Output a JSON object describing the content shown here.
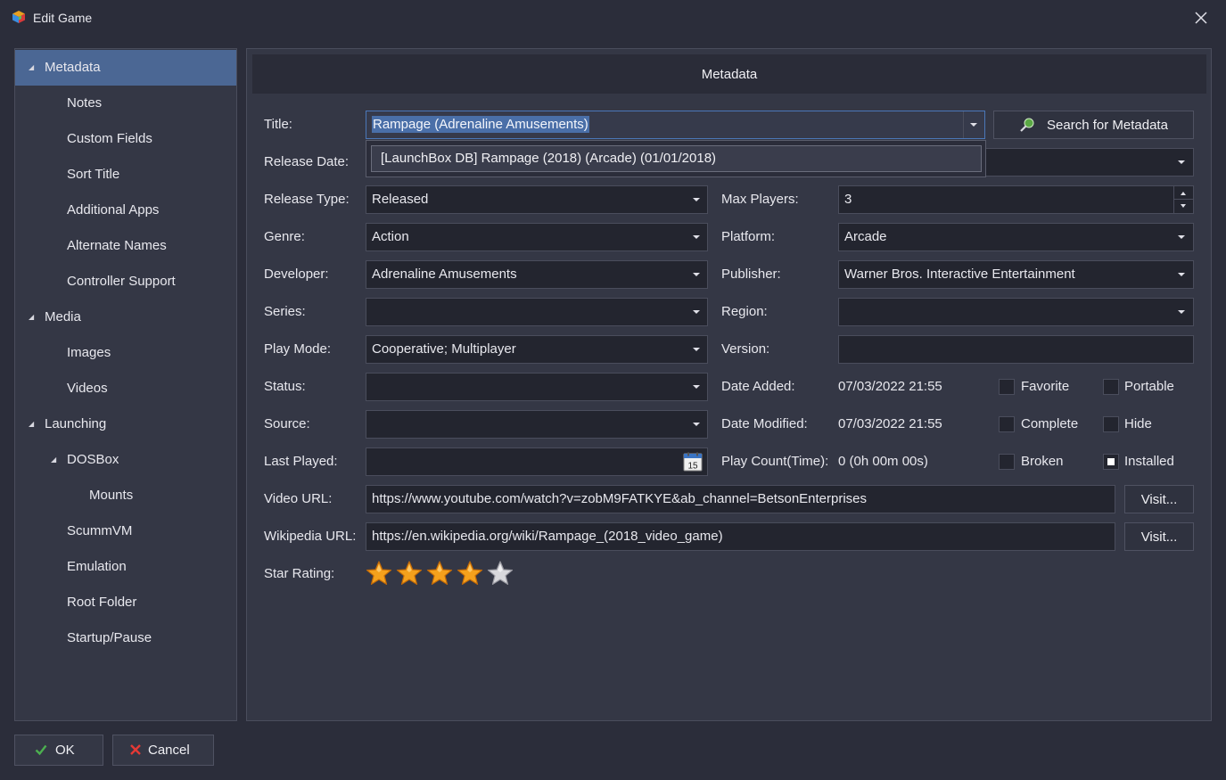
{
  "window": {
    "title": "Edit Game",
    "app_icon": "launchbox-cube-icon",
    "close_icon": "close-icon"
  },
  "sidebar": {
    "items": [
      {
        "label": "Metadata",
        "expander": true,
        "active": true
      },
      {
        "label": "Notes"
      },
      {
        "label": "Custom Fields"
      },
      {
        "label": "Sort Title"
      },
      {
        "label": "Additional Apps"
      },
      {
        "label": "Alternate Names"
      },
      {
        "label": "Controller Support"
      },
      {
        "label": "Media",
        "expander": true
      },
      {
        "label": "Images"
      },
      {
        "label": "Videos"
      },
      {
        "label": "Launching",
        "expander": true
      },
      {
        "label": "DOSBox",
        "expander": true
      },
      {
        "label": "Mounts"
      },
      {
        "label": "ScummVM"
      },
      {
        "label": "Emulation"
      },
      {
        "label": "Root Folder"
      },
      {
        "label": "Startup/Pause"
      }
    ]
  },
  "main": {
    "header": "Metadata",
    "search_button": "Search for Metadata",
    "title_autocomplete": "[LaunchBox DB] Rampage (2018) (Arcade) (01/01/2018)",
    "labels": {
      "title": "Title:",
      "release_date": "Release Date:",
      "release_type": "Release Type:",
      "genre": "Genre:",
      "developer": "Developer:",
      "series": "Series:",
      "play_mode": "Play Mode:",
      "status": "Status:",
      "source": "Source:",
      "last_played": "Last Played:",
      "video_url": "Video URL:",
      "wikipedia_url": "Wikipedia URL:",
      "star_rating": "Star Rating:",
      "max_players": "Max Players:",
      "platform": "Platform:",
      "publisher": "Publisher:",
      "region": "Region:",
      "version": "Version:",
      "date_added": "Date Added:",
      "date_modified": "Date Modified:",
      "play_count": "Play Count(Time):"
    },
    "values": {
      "title": "Rampage (Adrenaline Amusements)",
      "release_date": "",
      "release_type": "Released",
      "genre": "Action",
      "developer": "Adrenaline Amusements",
      "series": "",
      "play_mode": "Cooperative; Multiplayer",
      "status": "",
      "source": "",
      "last_played": "",
      "video_url": "https://www.youtube.com/watch?v=zobM9FATKYE&ab_channel=BetsonEnterprises",
      "wikipedia_url": "https://en.wikipedia.org/wiki/Rampage_(2018_video_game)",
      "max_players": "3",
      "platform": "Arcade",
      "publisher": "Warner Bros. Interactive Entertainment",
      "region": "",
      "version": "",
      "date_added": "07/03/2022 21:55",
      "date_modified": "07/03/2022 21:55",
      "play_count": "0 (0h 00m 00s)"
    },
    "calendar_day": "15",
    "visit_button": "Visit...",
    "checkboxes": {
      "favorite": {
        "label": "Favorite",
        "checked": false
      },
      "portable": {
        "label": "Portable",
        "checked": false
      },
      "complete": {
        "label": "Complete",
        "checked": false
      },
      "hide": {
        "label": "Hide",
        "checked": false
      },
      "broken": {
        "label": "Broken",
        "checked": false
      },
      "installed": {
        "label": "Installed",
        "checked": true
      }
    },
    "star_rating": {
      "value": 4,
      "max": 5
    }
  },
  "footer": {
    "ok": "OK",
    "cancel": "Cancel"
  },
  "colors": {
    "background": "#2b2d3a",
    "panel": "#343745",
    "field": "#23252f",
    "active_nav": "#4b6794",
    "selection": "#4a6fa8",
    "ok_green": "#4caf50",
    "cancel_red": "#e53935",
    "star_orange": "#f5a11c"
  }
}
